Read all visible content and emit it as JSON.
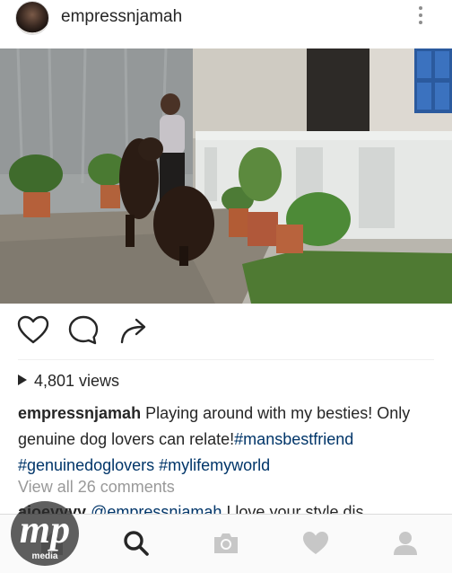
{
  "header": {
    "username": "empressnjamah",
    "avatar_icon": "profile-avatar",
    "more_icon": "vertical-ellipsis-icon"
  },
  "post": {
    "photo_description_icon": "video-thumbnail",
    "actions": {
      "like_icon": "heart-outline-icon",
      "comment_icon": "speech-bubble-icon",
      "share_icon": "share-arrow-icon"
    },
    "views_count": "4,801 views",
    "caption": {
      "username": "empressnjamah",
      "text": " Playing around with my besties! Only genuine dog lovers can relate!",
      "hashtags": [
        "#mansbestfriend",
        "#genuinedoglovers",
        "#mylifemyworld"
      ]
    },
    "view_all_comments": "View all 26 comments",
    "comment_preview": {
      "user": "ajoeyyyy",
      "mention": "@empressnjamah",
      "text": " I love your style dis"
    }
  },
  "tabbar": {
    "icons": [
      "home-icon",
      "search-icon",
      "camera-icon",
      "heart-icon",
      "profile-icon"
    ]
  },
  "watermark": {
    "brand": "mp",
    "sub": "media"
  }
}
